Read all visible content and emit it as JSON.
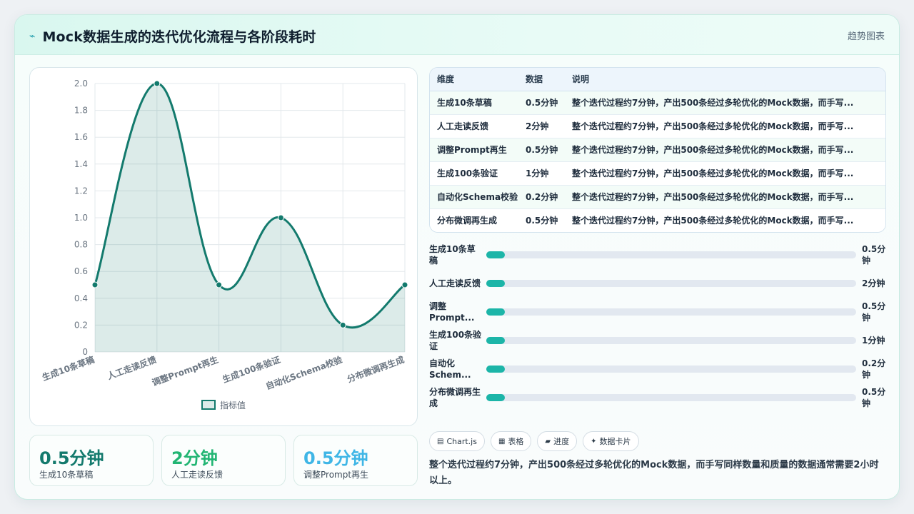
{
  "header": {
    "title": "Mock数据生成的迭代优化流程与各阶段耗时",
    "right_label": "趋势图表",
    "bolt_icon": "⌁"
  },
  "chart_data": {
    "type": "line",
    "categories": [
      "生成10条草稿",
      "人工走读反馈",
      "调整Prompt再生",
      "生成100条验证",
      "自动化Schema校验",
      "分布微调再生成"
    ],
    "series": [
      {
        "name": "指标值",
        "values": [
          0.5,
          2,
          0.5,
          1,
          0.2,
          0.5
        ],
        "color": "#137a6d",
        "fill": "rgba(19,122,109,0.15)"
      }
    ],
    "ylim": [
      0,
      2
    ],
    "yticks": [
      "0",
      "0.2",
      "0.4",
      "0.6",
      "0.8",
      "1.0",
      "1.2",
      "1.4",
      "1.6",
      "1.8",
      "2.0"
    ],
    "grid": true,
    "legend_position": "bottom"
  },
  "stats": [
    {
      "value": "0.5分钟",
      "label": "生成10条草稿",
      "color": "#137a6d"
    },
    {
      "value": "2分钟",
      "label": "人工走读反馈",
      "color": "#22b573"
    },
    {
      "value": "0.5分钟",
      "label": "调整Prompt再生",
      "color": "#3fb6e6"
    }
  ],
  "table": {
    "headers": [
      "维度",
      "数据",
      "说明"
    ],
    "rows": [
      [
        "生成10条草稿",
        "0.5分钟",
        "整个迭代过程约7分钟，产出500条经过多轮优化的Mock数据，而手写..."
      ],
      [
        "人工走读反馈",
        "2分钟",
        "整个迭代过程约7分钟，产出500条经过多轮优化的Mock数据，而手写..."
      ],
      [
        "调整Prompt再生",
        "0.5分钟",
        "整个迭代过程约7分钟，产出500条经过多轮优化的Mock数据，而手写..."
      ],
      [
        "生成100条验证",
        "1分钟",
        "整个迭代过程约7分钟，产出500条经过多轮优化的Mock数据，而手写..."
      ],
      [
        "自动化Schema校验",
        "0.2分钟",
        "整个迭代过程约7分钟，产出500条经过多轮优化的Mock数据，而手写..."
      ],
      [
        "分布微调再生成",
        "0.5分钟",
        "整个迭代过程约7分钟，产出500条经过多轮优化的Mock数据，而手写..."
      ]
    ]
  },
  "progress": [
    {
      "name": "生成10条草稿",
      "value": "0.5分钟",
      "fraction": 0.05
    },
    {
      "name": "人工走读反馈",
      "value": "2分钟",
      "fraction": 0.05
    },
    {
      "name": "调整Prompt...",
      "value": "0.5分钟",
      "fraction": 0.05
    },
    {
      "name": "生成100条验证",
      "value": "1分钟",
      "fraction": 0.05
    },
    {
      "name": "自动化Schem...",
      "value": "0.2分钟",
      "fraction": 0.05
    },
    {
      "name": "分布微调再生成",
      "value": "0.5分钟",
      "fraction": 0.05
    }
  ],
  "chips": [
    {
      "icon": "▤",
      "label": "Chart.js"
    },
    {
      "icon": "▦",
      "label": "表格"
    },
    {
      "icon": "▰",
      "label": "进度"
    },
    {
      "icon": "✦",
      "label": "数据卡片"
    }
  ],
  "summary": "整个迭代过程约7分钟，产出500条经过多轮优化的Mock数据，而手写同样数量和质量的数据通常需要2小时以上。"
}
